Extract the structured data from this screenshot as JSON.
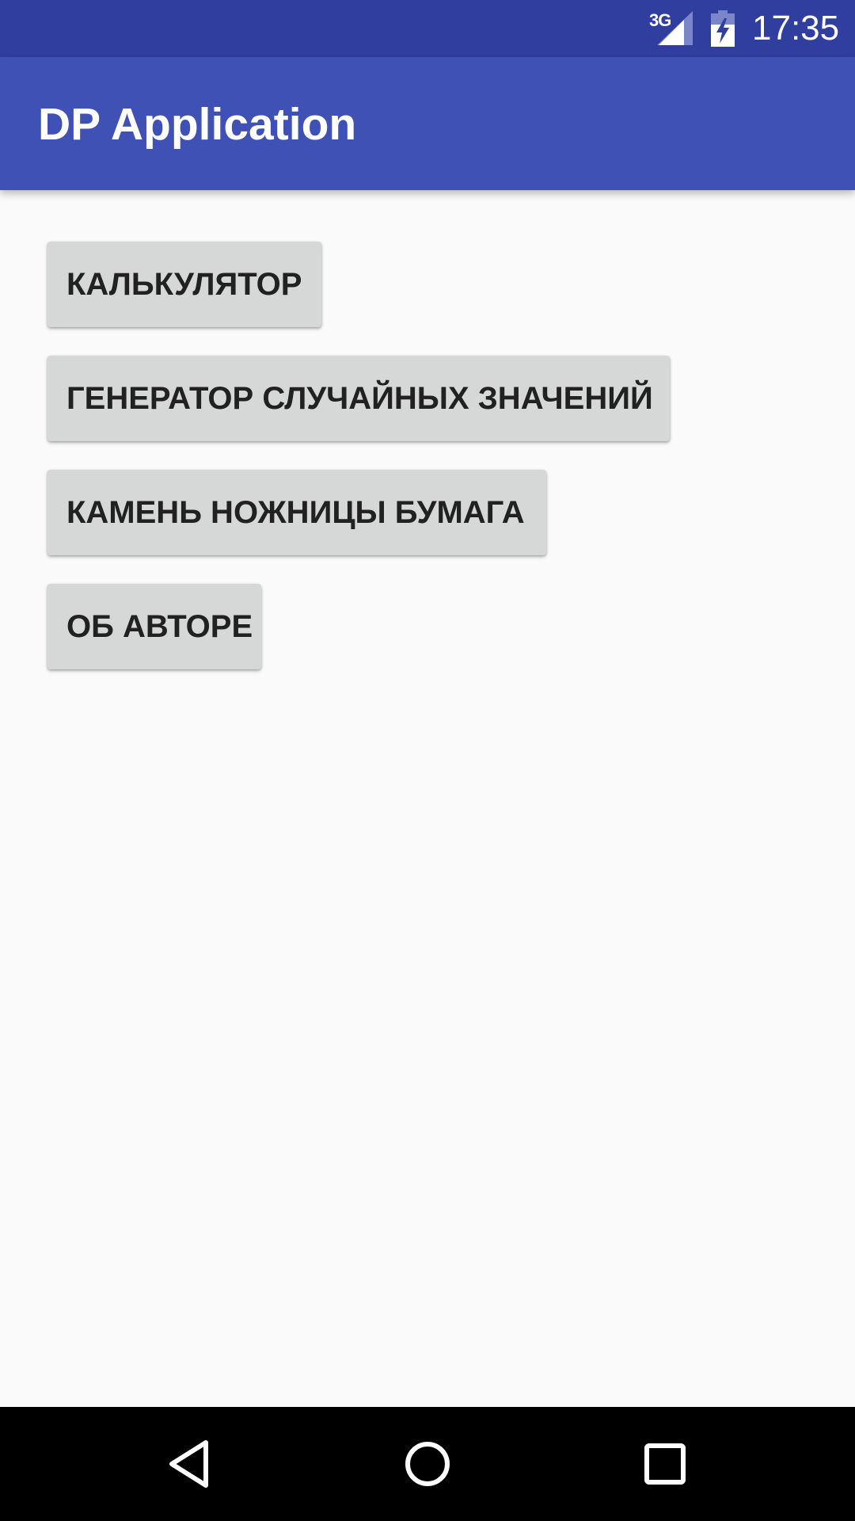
{
  "status_bar": {
    "network_label": "3G",
    "time": "17:35",
    "background_color": "#303f9f",
    "icons": [
      "signal-icon",
      "battery-charging-icon"
    ]
  },
  "app_bar": {
    "title": "DP Application",
    "background_color": "#3f51b5"
  },
  "buttons": [
    {
      "label": "КАЛЬКУЛЯТОР"
    },
    {
      "label": "ГЕНЕРАТОР СЛУЧАЙНЫХ ЗНАЧЕНИЙ"
    },
    {
      "label": "КАМЕНЬ НОЖНИЦЫ БУМАГА"
    },
    {
      "label": "ОБ АВТОРЕ"
    }
  ],
  "nav_bar": {
    "icons": [
      "back-icon",
      "home-icon",
      "recent-apps-icon"
    ]
  }
}
